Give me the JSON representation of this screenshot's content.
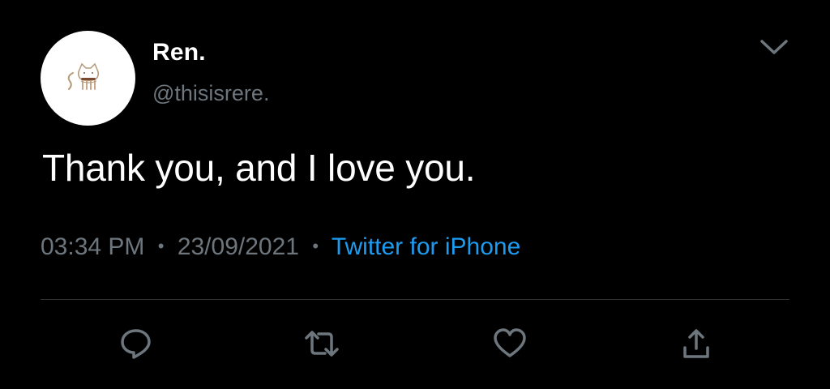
{
  "user": {
    "display_name": "Ren.",
    "handle": "@thisisrere.",
    "avatar_icon": "cat-avatar-icon"
  },
  "tweet": {
    "text": "Thank you, and I love you.",
    "time": "03:34 PM",
    "date": "23/09/2021",
    "separator": "•",
    "source": "Twitter for iPhone"
  },
  "actions": [
    {
      "icon": "reply-icon"
    },
    {
      "icon": "retweet-icon"
    },
    {
      "icon": "like-icon"
    },
    {
      "icon": "share-icon"
    }
  ],
  "colors": {
    "background": "#000000",
    "primary_text": "#ffffff",
    "secondary_text": "#6e767d",
    "link": "#1d9bf0",
    "divider": "#2f3336"
  }
}
